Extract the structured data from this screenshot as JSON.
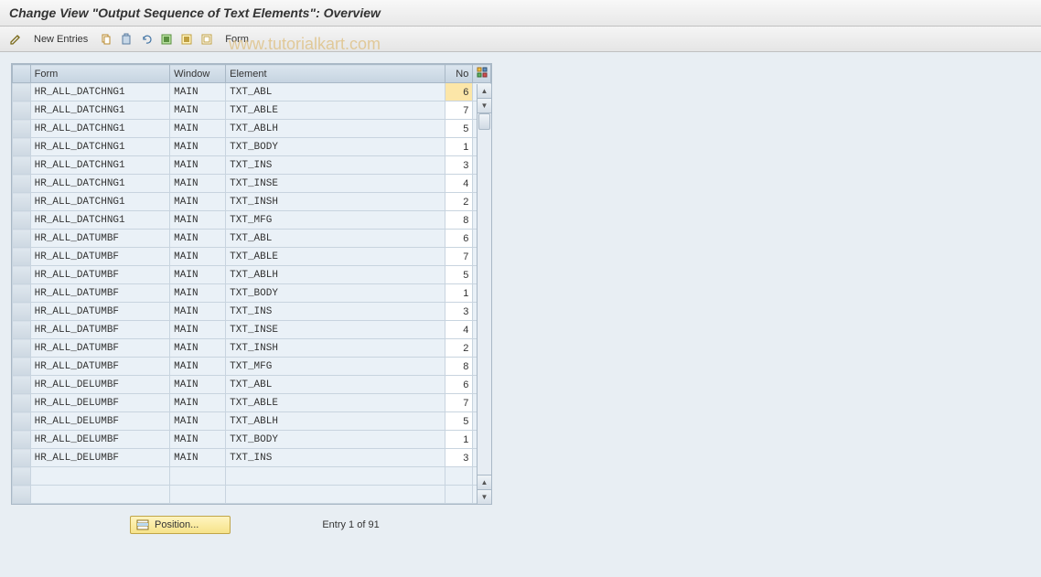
{
  "title": "Change View \"Output Sequence of Text Elements\": Overview",
  "toolbar": {
    "new_entries": "New Entries",
    "form": "Form"
  },
  "watermark": "www.tutorialkart.com",
  "table": {
    "headers": {
      "form": "Form",
      "window": "Window",
      "element": "Element",
      "no": "No"
    },
    "rows": [
      {
        "form": "HR_ALL_DATCHNG1",
        "window": "MAIN",
        "element": "TXT_ABL",
        "no": "6"
      },
      {
        "form": "HR_ALL_DATCHNG1",
        "window": "MAIN",
        "element": "TXT_ABLE",
        "no": "7"
      },
      {
        "form": "HR_ALL_DATCHNG1",
        "window": "MAIN",
        "element": "TXT_ABLH",
        "no": "5"
      },
      {
        "form": "HR_ALL_DATCHNG1",
        "window": "MAIN",
        "element": "TXT_BODY",
        "no": "1"
      },
      {
        "form": "HR_ALL_DATCHNG1",
        "window": "MAIN",
        "element": "TXT_INS",
        "no": "3"
      },
      {
        "form": "HR_ALL_DATCHNG1",
        "window": "MAIN",
        "element": "TXT_INSE",
        "no": "4"
      },
      {
        "form": "HR_ALL_DATCHNG1",
        "window": "MAIN",
        "element": "TXT_INSH",
        "no": "2"
      },
      {
        "form": "HR_ALL_DATCHNG1",
        "window": "MAIN",
        "element": "TXT_MFG",
        "no": "8"
      },
      {
        "form": "HR_ALL_DATUMBF",
        "window": "MAIN",
        "element": "TXT_ABL",
        "no": "6"
      },
      {
        "form": "HR_ALL_DATUMBF",
        "window": "MAIN",
        "element": "TXT_ABLE",
        "no": "7"
      },
      {
        "form": "HR_ALL_DATUMBF",
        "window": "MAIN",
        "element": "TXT_ABLH",
        "no": "5"
      },
      {
        "form": "HR_ALL_DATUMBF",
        "window": "MAIN",
        "element": "TXT_BODY",
        "no": "1"
      },
      {
        "form": "HR_ALL_DATUMBF",
        "window": "MAIN",
        "element": "TXT_INS",
        "no": "3"
      },
      {
        "form": "HR_ALL_DATUMBF",
        "window": "MAIN",
        "element": "TXT_INSE",
        "no": "4"
      },
      {
        "form": "HR_ALL_DATUMBF",
        "window": "MAIN",
        "element": "TXT_INSH",
        "no": "2"
      },
      {
        "form": "HR_ALL_DATUMBF",
        "window": "MAIN",
        "element": "TXT_MFG",
        "no": "8"
      },
      {
        "form": "HR_ALL_DELUMBF",
        "window": "MAIN",
        "element": "TXT_ABL",
        "no": "6"
      },
      {
        "form": "HR_ALL_DELUMBF",
        "window": "MAIN",
        "element": "TXT_ABLE",
        "no": "7"
      },
      {
        "form": "HR_ALL_DELUMBF",
        "window": "MAIN",
        "element": "TXT_ABLH",
        "no": "5"
      },
      {
        "form": "HR_ALL_DELUMBF",
        "window": "MAIN",
        "element": "TXT_BODY",
        "no": "1"
      },
      {
        "form": "HR_ALL_DELUMBF",
        "window": "MAIN",
        "element": "TXT_INS",
        "no": "3"
      }
    ]
  },
  "footer": {
    "position_label": "Position...",
    "entry_text": "Entry 1 of 91"
  }
}
